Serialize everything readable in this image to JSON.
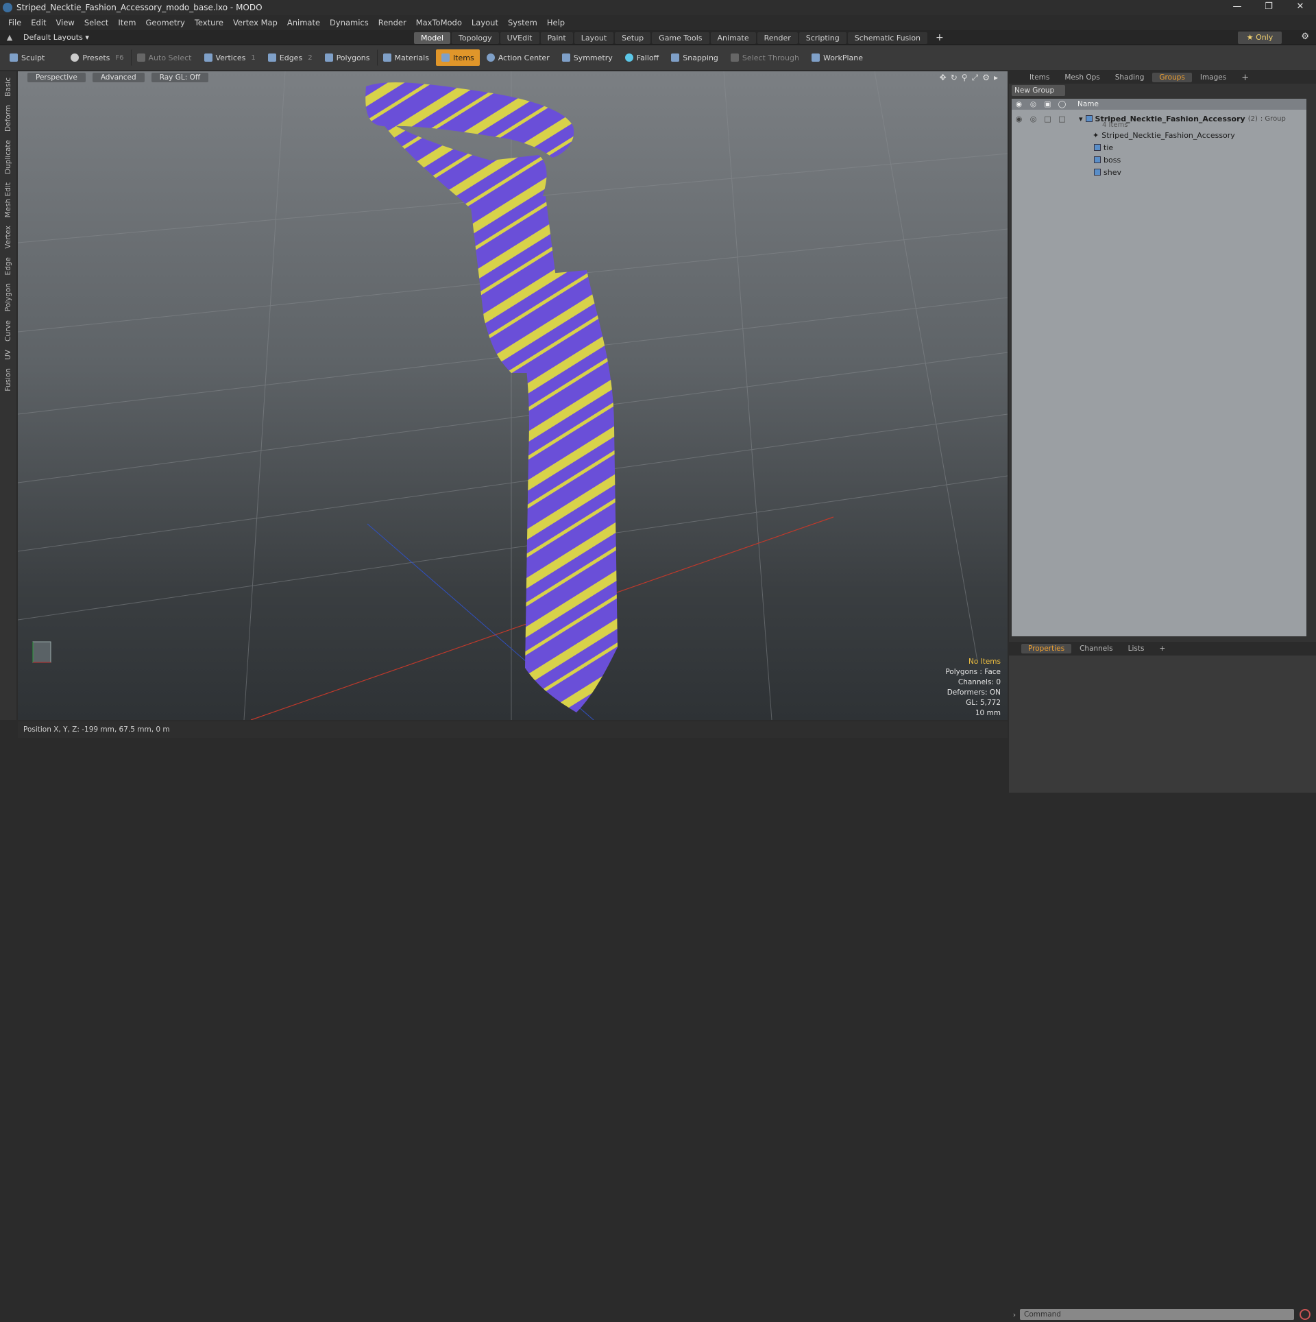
{
  "window": {
    "title": "Striped_Necktie_Fashion_Accessory_modo_base.lxo - MODO"
  },
  "menu": [
    "File",
    "Edit",
    "View",
    "Select",
    "Item",
    "Geometry",
    "Texture",
    "Vertex Map",
    "Animate",
    "Dynamics",
    "Render",
    "MaxToModo",
    "Layout",
    "System",
    "Help"
  ],
  "layout": {
    "layouts_label": "Default Layouts",
    "tabs": [
      "Model",
      "Topology",
      "UVEdit",
      "Paint",
      "Layout",
      "Setup",
      "Game Tools",
      "Animate",
      "Render",
      "Scripting",
      "Schematic Fusion"
    ],
    "active_tab": "Model",
    "only_label": "Only"
  },
  "toolbar": {
    "sculpt": "Sculpt",
    "presets": "Presets",
    "presets_key": "F6",
    "auto_select": "Auto Select",
    "vertices": "Vertices",
    "vertices_key": "1",
    "edges": "Edges",
    "edges_key": "2",
    "polygons": "Polygons",
    "materials": "Materials",
    "items": "Items",
    "action_center": "Action Center",
    "symmetry": "Symmetry",
    "falloff": "Falloff",
    "snapping": "Snapping",
    "select_through": "Select Through",
    "workplane": "WorkPlane"
  },
  "left_tabs": [
    "Basic",
    "Deform",
    "Duplicate",
    "Mesh Edit",
    "Vertex",
    "Edge",
    "Polygon",
    "Curve",
    "UV",
    "Fusion"
  ],
  "viewport": {
    "view": "Perspective",
    "advanced": "Advanced",
    "raygl": "Ray GL: Off",
    "info": {
      "no_items": "No Items",
      "polygons": "Polygons : Face",
      "channels": "Channels: 0",
      "deformers": "Deformers: ON",
      "gl": "GL: 5,772",
      "scale": "10 mm"
    },
    "tie_colors": {
      "base": "#6a4fd8",
      "stripe": "#d8d24a"
    }
  },
  "status": {
    "position": "Position X, Y, Z:  -199 mm, 67.5 mm, 0 m"
  },
  "right_panel": {
    "tabs": [
      "Items",
      "Mesh Ops",
      "Shading",
      "Groups",
      "Images"
    ],
    "active_tab": "Groups",
    "new_group": "New Group",
    "name_header": "Name",
    "group": {
      "name": "Striped_Necktie_Fashion_Accessory",
      "count": "(2)",
      "type": ": Group",
      "items_count": "4 Items"
    },
    "items": [
      "Striped_Necktie_Fashion_Accessory",
      "tie",
      "boss",
      "shev"
    ],
    "bottom_tabs": [
      "Properties",
      "Channels",
      "Lists"
    ],
    "bottom_active": "Properties",
    "command_placeholder": "Command"
  }
}
